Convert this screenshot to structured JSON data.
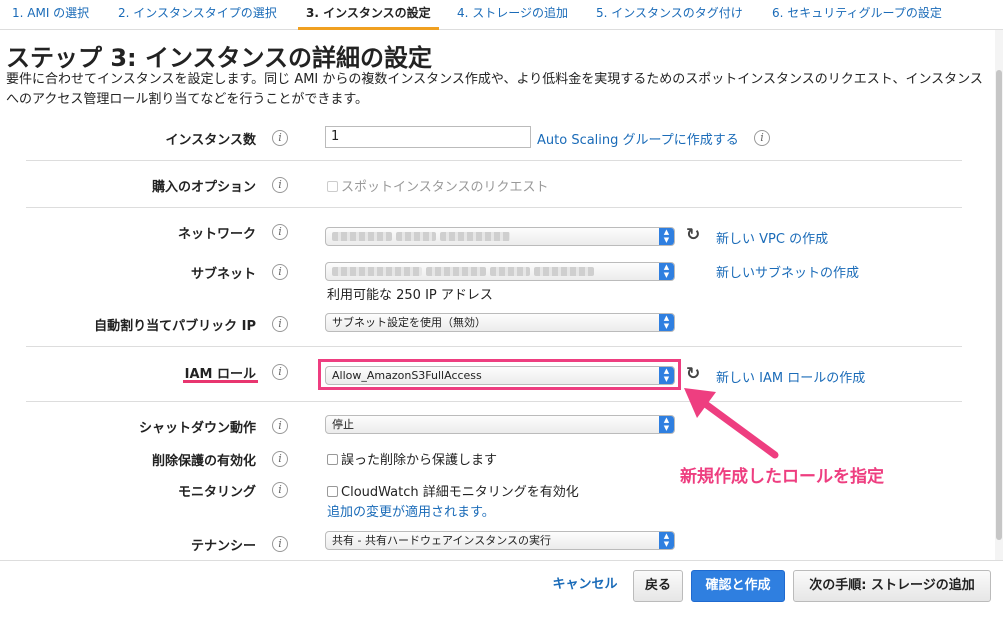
{
  "tabs": [
    {
      "label": "1. AMI の選択"
    },
    {
      "label": "2. インスタンスタイプの選択"
    },
    {
      "label": "3. インスタンスの設定"
    },
    {
      "label": "4. ストレージの追加"
    },
    {
      "label": "5. インスタンスのタグ付け"
    },
    {
      "label": "6. セキュリティグループの設定"
    }
  ],
  "page": {
    "title": "ステップ 3: インスタンスの詳細の設定",
    "description": "要件に合わせてインスタンスを設定します。同じ AMI からの複数インスタンス作成や、より低料金を実現するためのスポットインスタンスのリクエスト、インスタンスへのアクセス管理ロール割り当てなどを行うことができます。"
  },
  "form": {
    "instance_count": {
      "label": "インスタンス数",
      "value": "1",
      "link": "Auto Scaling グループに作成する"
    },
    "purchase": {
      "label": "購入のオプション",
      "checkbox": "スポットインスタンスのリクエスト"
    },
    "network": {
      "label": "ネットワーク",
      "link": "新しい VPC の作成"
    },
    "subnet": {
      "label": "サブネット",
      "link": "新しいサブネットの作成",
      "note": "利用可能な 250 IP アドレス"
    },
    "public_ip": {
      "label": "自動割り当てパブリック IP",
      "value": "サブネット設定を使用（無効）"
    },
    "iam_role": {
      "label": "IAM ロール",
      "value": "Allow_AmazonS3FullAccess",
      "link": "新しい IAM ロールの作成"
    },
    "shutdown": {
      "label": "シャットダウン動作",
      "value": "停止"
    },
    "termination": {
      "label": "削除保護の有効化",
      "checkbox": "誤った削除から保護します"
    },
    "monitoring": {
      "label": "モニタリング",
      "checkbox": "CloudWatch 詳細モニタリングを有効化",
      "note": "追加の変更が適用されます。"
    },
    "tenancy": {
      "label": "テナンシー",
      "value": "共有 - 共有ハードウェアインスタンスの実行"
    }
  },
  "annotation": {
    "text": "新規作成したロールを指定",
    "color": "#ee3e80"
  },
  "footer": {
    "cancel": "キャンセル",
    "back": "戻る",
    "review": "確認と作成",
    "next": "次の手順: ストレージの追加"
  },
  "colors": {
    "accent": "#2f7fe0",
    "link": "#1a6bb8",
    "highlight": "#ee3e80",
    "active_tab": "#f0a020"
  },
  "icons": {
    "info": "info-icon",
    "refresh": "refresh-icon",
    "dropdown": "chevron-updown-icon"
  }
}
